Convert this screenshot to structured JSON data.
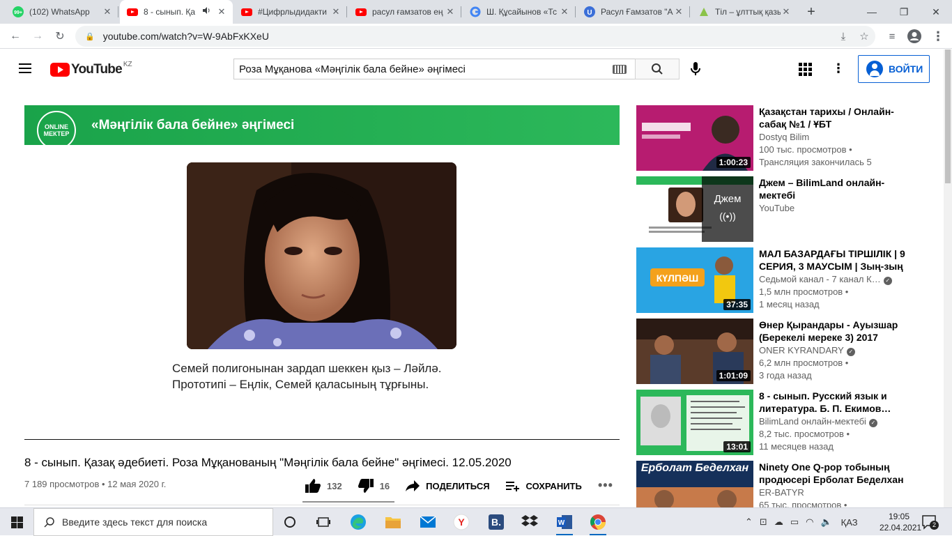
{
  "browser": {
    "tabs": [
      {
        "title": "(102) WhatsApp",
        "favicon": "whatsapp-icon",
        "active": false
      },
      {
        "title": "8 - сынып. Қа",
        "favicon": "youtube-icon",
        "active": true,
        "audio": true
      },
      {
        "title": "#Цифрлыдидакти",
        "favicon": "youtube-icon",
        "active": false
      },
      {
        "title": "расул ғамзатов ең",
        "favicon": "youtube-icon",
        "active": false
      },
      {
        "title": "Ш. Құсайынов «Тс",
        "favicon": "google-icon",
        "active": false
      },
      {
        "title": "Расул Ғамзатов \"А",
        "favicon": "u-site-icon",
        "active": false
      },
      {
        "title": "Тіл – ұлттық қазы",
        "favicon": "site-icon",
        "active": false
      }
    ],
    "whatsapp_badge": "99+",
    "url": "youtube.com/watch?v=W-9AbFxKXeU"
  },
  "youtube": {
    "logo_text": "YouTube",
    "country": "KZ",
    "search_query": "Роза Мұқанова «Мәңгілік бала бейне» әңгімесі",
    "signin_label": "ВОЙТИ",
    "accent": "#065fd4",
    "brand_red": "#ff0000"
  },
  "player": {
    "banner_logo_line1": "ONLINE",
    "banner_logo_line2": "МЕКТЕР",
    "banner_title": "«Мәңгілік бала бейне» әңгімесі",
    "caption_line1": "Семей полигонынан зардап шеккен қыз – Ләйлә.",
    "caption_line2": "Прототипі – Еңлік, Семей қаласының тұрғыны."
  },
  "video": {
    "title": "8 - сынып. Қазақ әдебиеті. Роза Мұқанованың \"Мәңгілік бала бейне\" әңгімесі. 12.05.2020",
    "views": "7 189 просмотров",
    "date": "12 мая 2020 г.",
    "likes": "132",
    "dislikes": "16",
    "share_label": "ПОДЕЛИТЬСЯ",
    "save_label": "СОХРАНИТЬ",
    "like_ratio": 0.89
  },
  "related": [
    {
      "title": "Қазақстан тарихы / Онлайн-сабақ №1 / ҰБТ",
      "channel": "Dostyq Bilim",
      "verified": false,
      "meta1": "100 тыс. просмотров •",
      "meta2": "Трансляция закончилась 5",
      "duration": "1:00:23",
      "thumb_color": "#c2237a"
    },
    {
      "title": "Джем – BilimLand онлайн-мектебі",
      "channel": "YouTube",
      "verified": false,
      "meta1": "",
      "meta2": "",
      "duration": "",
      "overlay": "Джем",
      "thumb_color": "#2cb85a"
    },
    {
      "title": "МАЛ БАЗАРДАҒЫ ТІРШІЛІК | 9 СЕРИЯ, 3 МАУСЫМ | Зың-зың",
      "channel": "Седьмой канал - 7 канал К…",
      "verified": true,
      "meta1": "1,5 млн просмотров •",
      "meta2": "1 месяц назад",
      "duration": "37:35",
      "thumb_color": "#1fa0e0"
    },
    {
      "title": "Өнер Қырандары - Ауызшар (Берекелі мереке 3) 2017",
      "channel": "ONER KYRANDARY",
      "verified": true,
      "meta1": "6,2 млн просмотров •",
      "meta2": "3 года назад",
      "duration": "1:01:09",
      "thumb_color": "#5a3b2a"
    },
    {
      "title": "8 - сынып. Русский язык и литература. Б. П. Екимов…",
      "channel": "BilimLand онлайн-мектебі",
      "verified": true,
      "meta1": "8,2 тыс. просмотров •",
      "meta2": "11 месяцев назад",
      "duration": "13:01",
      "thumb_color": "#2cb85a"
    },
    {
      "title": "Ninety One Q-pop тобының продюсері Ерболат Беделхан",
      "channel": "ER-BATYR",
      "verified": false,
      "meta1": "65 тыс. просмотров •",
      "meta2": "",
      "duration": "",
      "thumb_color": "#15305a",
      "thumb_text": "Ерболат Беделхан"
    }
  ],
  "taskbar": {
    "search_placeholder": "Введите здесь текст для поиска",
    "language": "ҚАЗ",
    "time": "19:05",
    "date": "22.04.2021",
    "notifications": "2"
  }
}
